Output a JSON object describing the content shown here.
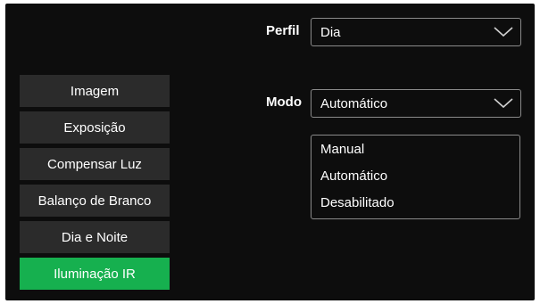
{
  "menu": {
    "items": [
      {
        "label": "Imagem"
      },
      {
        "label": "Exposição"
      },
      {
        "label": "Compensar Luz"
      },
      {
        "label": "Balanço de Branco"
      },
      {
        "label": "Dia e Noite"
      },
      {
        "label": "Iluminação IR",
        "active": true
      }
    ]
  },
  "profile": {
    "label": "Perfil",
    "value": "Dia"
  },
  "mode": {
    "label": "Modo",
    "value": "Automático",
    "options": [
      "Manual",
      "Automático",
      "Desabilitado"
    ]
  },
  "colors": {
    "background": "#0d0d0d",
    "menu_item": "#2b2b2b",
    "active": "#16b04f",
    "border": "#8a8a8a"
  },
  "icons": {
    "select_arrow": "chevron-down-icon"
  }
}
